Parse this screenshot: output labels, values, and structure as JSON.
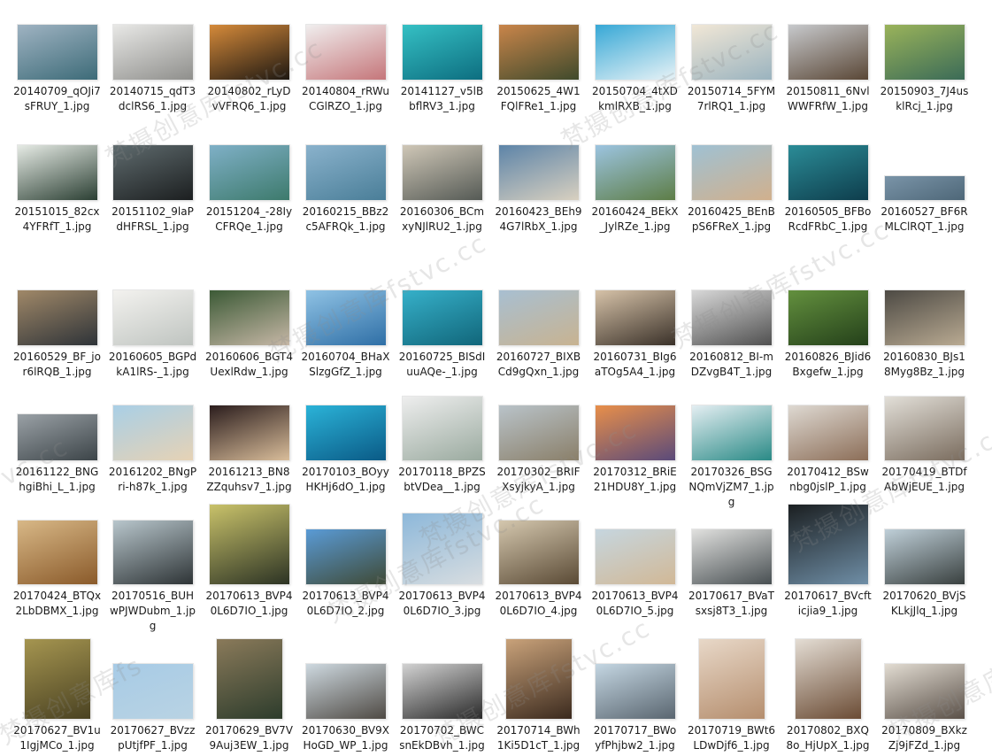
{
  "watermark": "梵摄创意库fstvc.cc",
  "watermark_edge_fragments": [
    "vc.cc",
    "梵摄创意库fs"
  ],
  "files": [
    {
      "name": "20140709_qOJi7sFRUY_1.jpg",
      "c1": "#9fb3c2",
      "c2": "#3d6b78"
    },
    {
      "name": "20140715_qdT3dclRS6_1.jpg",
      "c1": "#e8e8e6",
      "c2": "#8f8f8c"
    },
    {
      "name": "20140802_rLyDvVFRQ6_1.jpg",
      "c1": "#d58a3a",
      "c2": "#1e1812"
    },
    {
      "name": "20140804_rRWuCGlRZO_1.jpg",
      "c1": "#f0eeee",
      "c2": "#c5767a"
    },
    {
      "name": "20141127_v5lBbflRV3_1.jpg",
      "c1": "#35c0c4",
      "c2": "#0d6e80"
    },
    {
      "name": "20150625_4W1FQlFRe1_1.jpg",
      "c1": "#c9854a",
      "c2": "#3f4a2c"
    },
    {
      "name": "20150704_4tXDkmlRXB_1.jpg",
      "c1": "#37a8d6",
      "c2": "#e7f2f6"
    },
    {
      "name": "20150714_5FYM7rlRQ1_1.jpg",
      "c1": "#f1e7d6",
      "c2": "#9ab3bf"
    },
    {
      "name": "20150811_6NvlWWFRfW_1.jpg",
      "c1": "#c7c9cc",
      "c2": "#5a4736"
    },
    {
      "name": "20150903_7J4usklRcj_1.jpg",
      "c1": "#9ab35a",
      "c2": "#3b6b57"
    },
    {
      "name": "20151015_82cx4YFRfT_1.jpg",
      "c1": "#e6ebe5",
      "c2": "#2b3f33"
    },
    {
      "name": "20151102_9laPdHFRSL_1.jpg",
      "c1": "#5f6b6e",
      "c2": "#1c1f20"
    },
    {
      "name": "20151204_-28IyCFRQe_1.jpg",
      "c1": "#7fb0c7",
      "c2": "#3d7a6c"
    },
    {
      "name": "20160215_BBz2c5AFRQk_1.jpg",
      "c1": "#8ab2cc",
      "c2": "#4a7e98"
    },
    {
      "name": "20160306_BCmxyNJlRU2_1.jpg",
      "c1": "#cfc7b7",
      "c2": "#555a55"
    },
    {
      "name": "20160423_BEh94G7lRbX_1.jpg",
      "c1": "#5d84a8",
      "c2": "#d8d0c0"
    },
    {
      "name": "20160424_BEkX_JylRZe_1.jpg",
      "c1": "#9cc4e0",
      "c2": "#5d7d46"
    },
    {
      "name": "20160425_BEnBpS6FReX_1.jpg",
      "c1": "#9fc1d3",
      "c2": "#d1b08d"
    },
    {
      "name": "20160505_BFBoRcdFRbC_1.jpg",
      "c1": "#2b8c97",
      "c2": "#0e3d4c"
    },
    {
      "name": "20160527_BF6RMLClRQT_1.jpg",
      "c1": "#7a94a8",
      "c2": "#4e6778"
    },
    {
      "name": "20160529_BF_jor6lRQB_1.jpg",
      "c1": "#a08868",
      "c2": "#2e3338"
    },
    {
      "name": "20160605_BGPdkA1lRS-_1.jpg",
      "c1": "#f3f2ef",
      "c2": "#bfc4c0"
    },
    {
      "name": "20160606_BGT4UexlRdw_1.jpg",
      "c1": "#3c5a36",
      "c2": "#c6b7a6"
    },
    {
      "name": "20160704_BHaXSlzgGfZ_1.jpg",
      "c1": "#8fc2e4",
      "c2": "#2f6fa6"
    },
    {
      "name": "20160725_BISdIuuAQe-_1.jpg",
      "c1": "#36b0c9",
      "c2": "#11667a"
    },
    {
      "name": "20160727_BIXBCd9gQxn_1.jpg",
      "c1": "#a8bfd1",
      "c2": "#c8b391"
    },
    {
      "name": "20160731_BIg6aTOg5A4_1.jpg",
      "c1": "#d6c2a8",
      "c2": "#3a3129"
    },
    {
      "name": "20160812_BI-mDZvgB4T_1.jpg",
      "c1": "#d8d8d8",
      "c2": "#505050"
    },
    {
      "name": "20160826_BJid6Bxgefw_1.jpg",
      "c1": "#63903e",
      "c2": "#24401a"
    },
    {
      "name": "20160830_BJs18Myg8Bz_1.jpg",
      "c1": "#4d4a44",
      "c2": "#b9aa92"
    },
    {
      "name": "20161122_BNGhgiBhi_L_1.jpg",
      "c1": "#9aa1a6",
      "c2": "#3c4448"
    },
    {
      "name": "20161202_BNgPri-h87k_1.jpg",
      "c1": "#a9cfe6",
      "c2": "#e6d2b5"
    },
    {
      "name": "20161213_BN8ZZquhsv7_1.jpg",
      "c1": "#2b1d1d",
      "c2": "#d9bd9a"
    },
    {
      "name": "20170103_BOyyHKHj6dO_1.jpg",
      "c1": "#2bb3d8",
      "c2": "#0a5a86"
    },
    {
      "name": "20170118_BPZSbtVDea__1.jpg",
      "c1": "#eeeeee",
      "c2": "#9aaa9f"
    },
    {
      "name": "20170302_BRIFXsyjkyA_1.jpg",
      "c1": "#b9c3c9",
      "c2": "#8a7f69"
    },
    {
      "name": "20170312_BRiE21HDU8Y_1.jpg",
      "c1": "#e88f4a",
      "c2": "#5a4a7a"
    },
    {
      "name": "20170326_BSGNQmVjZM7_1.jpg",
      "c1": "#e4eef2",
      "c2": "#2a8a86"
    },
    {
      "name": "20170412_BSwnbg0jslP_1.jpg",
      "c1": "#ded9d2",
      "c2": "#8c6e58"
    },
    {
      "name": "20170419_BTDfAbWjEUE_1.jpg",
      "c1": "#e2dfd8",
      "c2": "#7a6c5e"
    },
    {
      "name": "20170424_BTQx2LbDBMX_1.jpg",
      "c1": "#d8b887",
      "c2": "#8a5a2a"
    },
    {
      "name": "20170516_BUHwPJWDubm_1.jpg",
      "c1": "#b8c6cc",
      "c2": "#2e3436"
    },
    {
      "name": "20170613_BVP40L6D7IO_1.jpg",
      "c1": "#c9c26a",
      "c2": "#2c3324"
    },
    {
      "name": "20170613_BVP40L6D7IO_2.jpg",
      "c1": "#5a9bd6",
      "c2": "#3f4a36"
    },
    {
      "name": "20170613_BVP40L6D7IO_3.jpg",
      "c1": "#8db8da",
      "c2": "#d8dde0"
    },
    {
      "name": "20170613_BVP40L6D7IO_4.jpg",
      "c1": "#d4c7ae",
      "c2": "#5a4a35"
    },
    {
      "name": "20170613_BVP40L6D7IO_5.jpg",
      "c1": "#c6d6df",
      "c2": "#d1b896"
    },
    {
      "name": "20170617_BVaTsxsj8T3_1.jpg",
      "c1": "#e1e1df",
      "c2": "#484f52"
    },
    {
      "name": "20170617_BVcfticjia9_1.jpg",
      "c1": "#1b1f21",
      "c2": "#6f8ea6"
    },
    {
      "name": "20170620_BVjSKLkjJlq_1.jpg",
      "c1": "#bfcfd8",
      "c2": "#39403f"
    },
    {
      "name": "20170627_BV1u1IgjMCo_1.jpg",
      "c1": "#a59550",
      "c2": "#4a4222"
    },
    {
      "name": "20170627_BVzzpUtjfPF_1.jpg",
      "c1": "#a7cbe6",
      "c2": "#b9d3e3"
    },
    {
      "name": "20170629_BV7V9Auj3EW_1.jpg",
      "c1": "#8a7a5a",
      "c2": "#2d3c2c"
    },
    {
      "name": "20170630_BV9XHoGD_WP_1.jpg",
      "c1": "#ced9e0",
      "c2": "#4f4a44"
    },
    {
      "name": "20170702_BWCsnEkDBvh_1.jpg",
      "c1": "#d2d2d2",
      "c2": "#2a2a2a"
    },
    {
      "name": "20170714_BWh1Ki5D1cT_1.jpg",
      "c1": "#c9a27a",
      "c2": "#3b2a1e"
    },
    {
      "name": "20170717_BWoyfPhjbw2_1.jpg",
      "c1": "#c4d6e2",
      "c2": "#5a6670"
    },
    {
      "name": "20170719_BWt6LDwDjf6_1.jpg",
      "c1": "#e8d8c8",
      "c2": "#b58e6e"
    },
    {
      "name": "20170802_BXQ8o_HjUpX_1.jpg",
      "c1": "#e4ddd4",
      "c2": "#6b4c35"
    },
    {
      "name": "20170809_BXkzZj9jFZd_1.jpg",
      "c1": "#e2dcd2",
      "c2": "#5a5048"
    }
  ]
}
